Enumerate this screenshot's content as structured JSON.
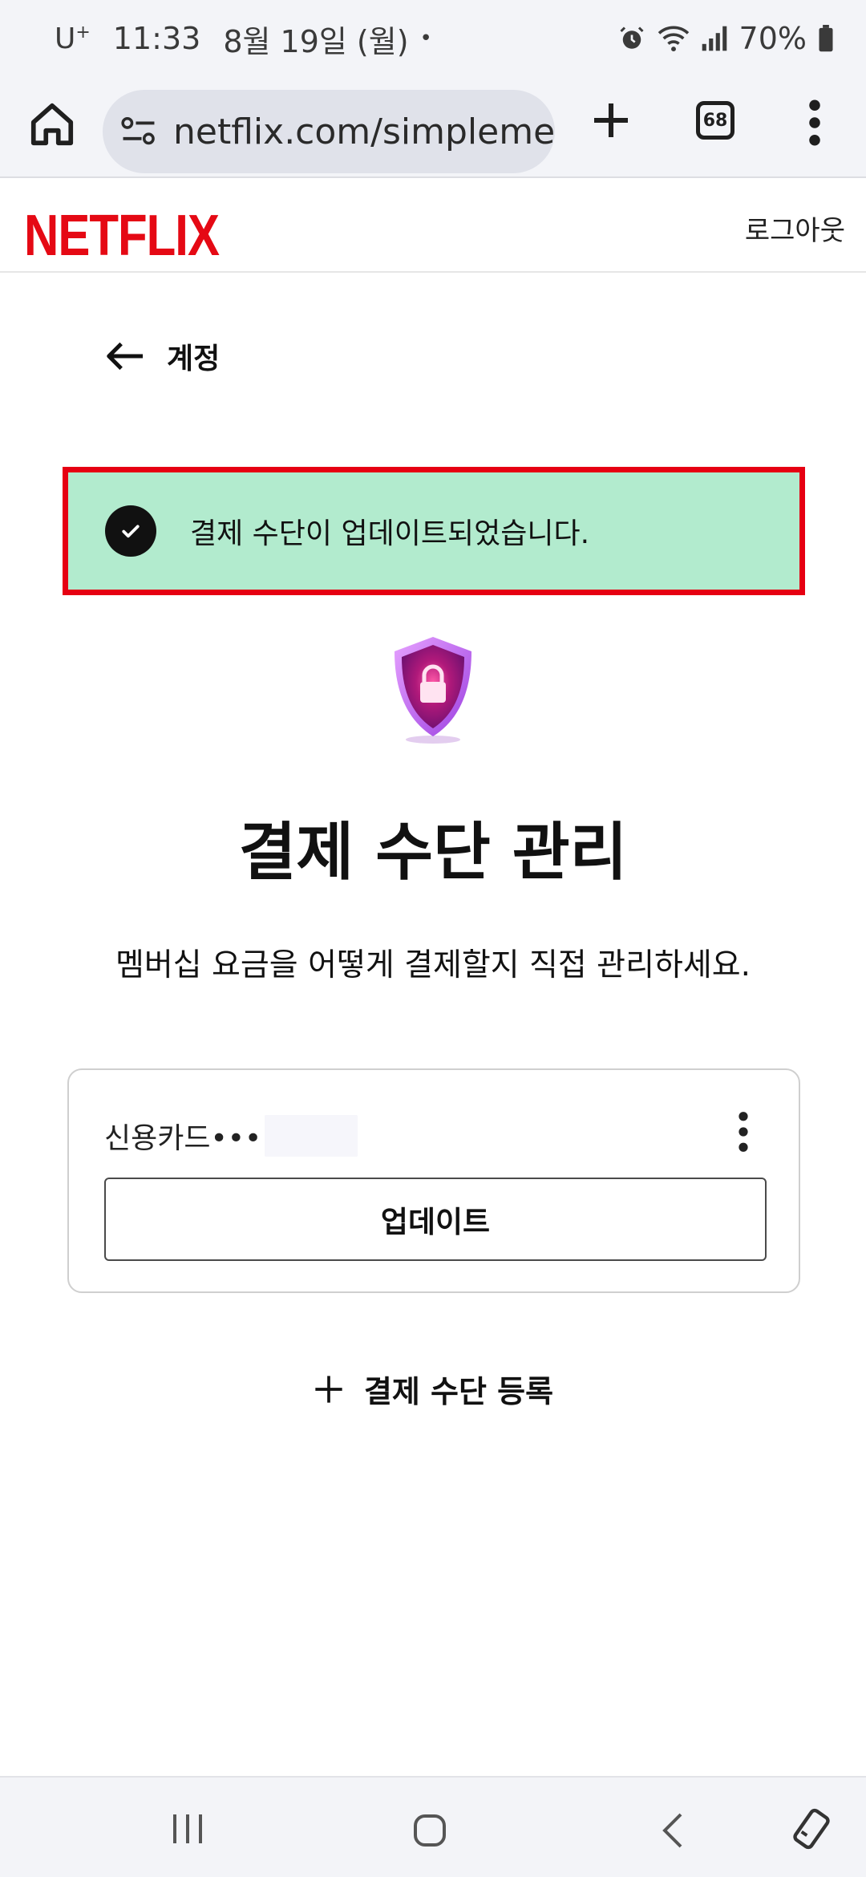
{
  "status_bar": {
    "carrier": "U",
    "carrier_sup": "+",
    "time": "11:33",
    "date": "8월 19일 (월)",
    "dot": "•",
    "battery": "70%",
    "icons": [
      "alarm-icon",
      "wifi-icon",
      "signal-icon",
      "battery-icon"
    ]
  },
  "browser": {
    "url": "netflix.com/simpleme",
    "tab_count": "68",
    "icons": [
      "home-icon",
      "site-settings-icon",
      "new-tab-icon",
      "tabs-icon",
      "more-vert-icon"
    ]
  },
  "header": {
    "logo": "NETFLIX",
    "logout": "로그아웃",
    "brand_color": "#e50914"
  },
  "back": {
    "label": "계정"
  },
  "banner": {
    "message": "결제 수단이 업데이트되었습니다.",
    "background": "#b2ebce",
    "highlight_border": "#e60012"
  },
  "main": {
    "title": "결제 수단 관리",
    "subtitle": "멤버십 요금을 어떻게 결제할지 직접 관리하세요."
  },
  "payment_card": {
    "label": "신용카드•••",
    "update_button": "업데이트"
  },
  "add_method": {
    "label": "결제 수단 등록"
  },
  "navbar": {
    "icons": [
      "recents-icon",
      "home-nav-icon",
      "back-nav-icon",
      "rotate-icon"
    ]
  }
}
